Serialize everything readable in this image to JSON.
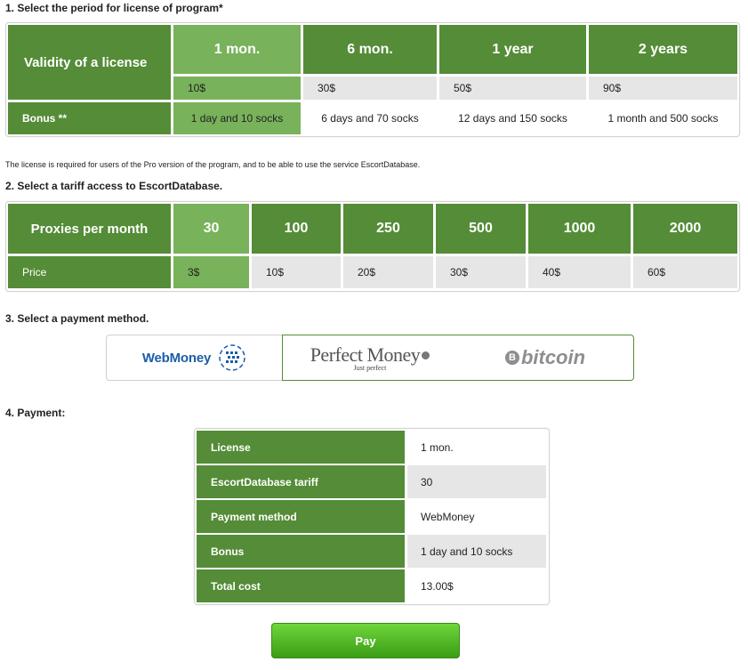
{
  "sections": {
    "s1": "1. Select the period for license of program*",
    "s2": "2. Select a tariff access to EscortDatabase.",
    "s3": "3. Select a payment method.",
    "s4": "4. Payment:"
  },
  "license_note": "The license is required for users of the Pro version of the program, and to be able to use the service EscortDatabase.",
  "license": {
    "row_label": "Validity of a license",
    "bonus_label": "Bonus **",
    "periods": [
      {
        "label": "1 mon.",
        "price": "10$",
        "bonus": "1 day and 10 socks",
        "selected": true
      },
      {
        "label": "6 mon.",
        "price": "30$",
        "bonus": "6 days and 70 socks",
        "selected": false
      },
      {
        "label": "1 year",
        "price": "50$",
        "bonus": "12 days and 150 socks",
        "selected": false
      },
      {
        "label": "2 years",
        "price": "90$",
        "bonus": "1 month and 500 socks",
        "selected": false
      }
    ]
  },
  "tariff": {
    "row_label": "Proxies per month",
    "price_label": "Price",
    "options": [
      {
        "label": "30",
        "price": "3$",
        "selected": true
      },
      {
        "label": "100",
        "price": "10$",
        "selected": false
      },
      {
        "label": "250",
        "price": "20$",
        "selected": false
      },
      {
        "label": "500",
        "price": "30$",
        "selected": false
      },
      {
        "label": "1000",
        "price": "40$",
        "selected": false
      },
      {
        "label": "2000",
        "price": "60$",
        "selected": false
      }
    ]
  },
  "payment_methods": {
    "webmoney": "WebMoney",
    "perfect_money": "Perfect Money",
    "perfect_money_tagline": "Just perfect",
    "bitcoin": "bitcoin",
    "selected": "webmoney"
  },
  "summary": [
    {
      "key": "License",
      "value": "1 mon."
    },
    {
      "key": "EscortDatabase tariff",
      "value": "30"
    },
    {
      "key": "Payment method",
      "value": "WebMoney"
    },
    {
      "key": "Bonus",
      "value": "1 day and 10 socks"
    },
    {
      "key": "Total cost",
      "value": "13.00$"
    }
  ],
  "pay_label": "Pay",
  "colors": {
    "green": "#548c37",
    "selected_green": "#78b25a",
    "gray": "#e6e6e6",
    "button_green": "#4cb225"
  }
}
